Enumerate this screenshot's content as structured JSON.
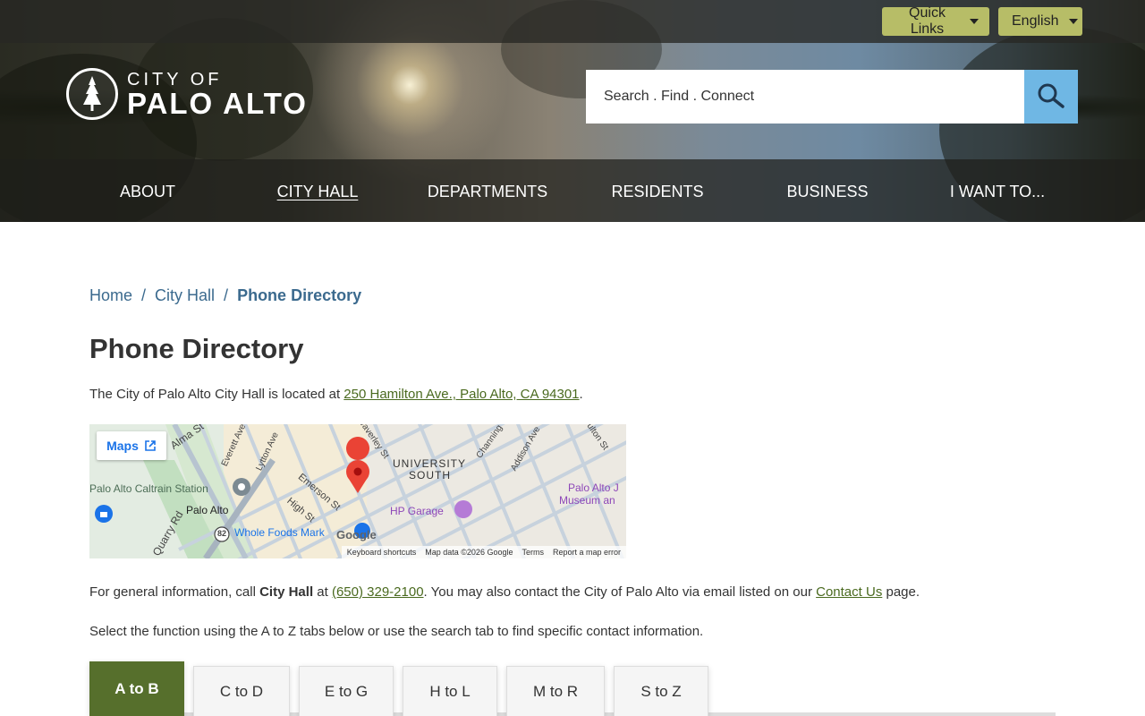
{
  "topbar": {
    "quick_links": "Quick Links",
    "language": "English"
  },
  "logo": {
    "line1": "CITY OF",
    "line2": "PALO ALTO"
  },
  "search": {
    "placeholder": "Search . Find . Connect"
  },
  "nav": {
    "items": [
      {
        "label": "ABOUT"
      },
      {
        "label": "CITY HALL"
      },
      {
        "label": "DEPARTMENTS"
      },
      {
        "label": "RESIDENTS"
      },
      {
        "label": "BUSINESS"
      },
      {
        "label": "I WANT TO..."
      }
    ]
  },
  "breadcrumb": {
    "home": "Home",
    "sep": "/",
    "city_hall": "City Hall",
    "current": "Phone Directory"
  },
  "page": {
    "title": "Phone Directory",
    "intro_pre": "The City of Palo Alto City Hall is located at ",
    "address": "250 Hamilton Ave., Palo Alto, CA 94301",
    "intro_post": ".",
    "info_pre": "For general information, call ",
    "info_bold": "City Hall",
    "info_at": " at ",
    "phone": "(650) 329-2100",
    "info_mid": ". You may also contact the City of Palo Alto via email listed on our ",
    "contact_link": "Contact Us",
    "info_post": " page.",
    "select_text": "Select the function using the A to Z tabs below or use the search tab to find specific contact information."
  },
  "map": {
    "maps_button": "Maps",
    "labels": {
      "alma": "Alma St",
      "everett": "Everett Ave",
      "lytton": "Lytton Ave",
      "waverley": "Waverley St",
      "university_south_1": "UNIVERSITY",
      "university_south_2": "SOUTH",
      "channing": "Channing",
      "addison": "Addison Ave",
      "fulton": "Fulton St",
      "caltrain": "Palo Alto Caltrain Station",
      "emerson": "Emerson St",
      "palo_alto": "Palo Alto",
      "high": "High St",
      "hp_garage": "HP Garage",
      "museum_1": "Palo Alto J",
      "museum_2": "Museum an",
      "quarry": "Quarry Rd",
      "route": "82",
      "whole_foods": "Whole Foods Mark",
      "google": "Google"
    },
    "footer": {
      "shortcuts": "Keyboard shortcuts",
      "data": "Map data ©2026 Google",
      "terms": "Terms",
      "report": "Report a map error"
    }
  },
  "tabs": [
    {
      "label": "A to B",
      "active": true
    },
    {
      "label": "C to D"
    },
    {
      "label": "E to G"
    },
    {
      "label": "H to L"
    },
    {
      "label": "M to R"
    },
    {
      "label": "S to Z"
    }
  ],
  "colors": {
    "accent_green": "#566f2c",
    "button_olive": "#b7bd67",
    "search_blue": "#6fb7e4",
    "link_blue": "#3b6a8e"
  }
}
